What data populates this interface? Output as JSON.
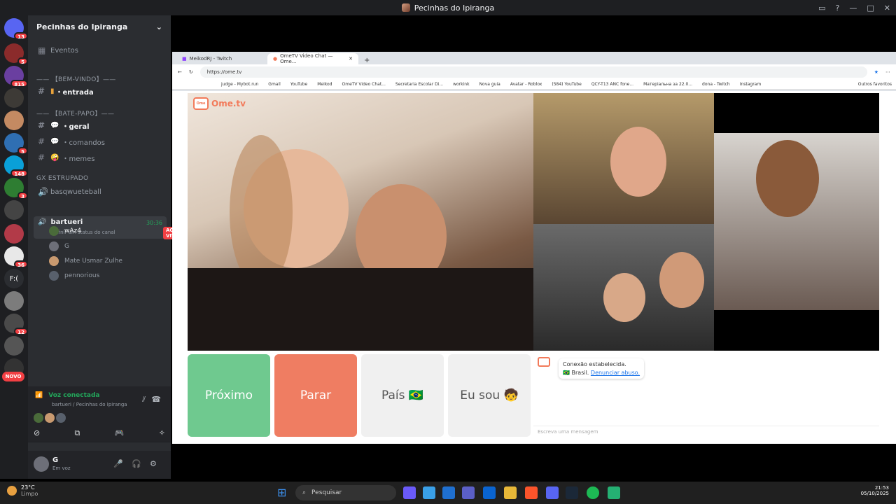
{
  "window": {
    "title": "Pecinhas do Ipiranga"
  },
  "servers": [
    {
      "badge": "13",
      "color": "#5865f2"
    },
    {
      "badge": "5",
      "color": "#8b2b2b"
    },
    {
      "badge": "815",
      "color": "#6a3fa0"
    },
    {
      "badge": "",
      "color": "#3d3a36"
    },
    {
      "badge": "",
      "color": "#c48a62"
    },
    {
      "badge": "5",
      "color": "#2f6fb3"
    },
    {
      "badge": "148",
      "color": "#0aa0d8"
    },
    {
      "badge": "3",
      "color": "#2e7d32"
    },
    {
      "badge": "",
      "color": "#444"
    },
    {
      "badge": "",
      "color": "#b23a48"
    },
    {
      "badge": "36",
      "color": "#e8e8e8"
    },
    {
      "badge": "",
      "color": "#2b2d31",
      "label": "F:("
    },
    {
      "badge": "",
      "color": "#7c7c7c"
    },
    {
      "badge": "12",
      "color": "#4a4a4a"
    },
    {
      "badge": "",
      "color": "#555"
    },
    {
      "badge": "",
      "color": "#333"
    }
  ],
  "novo_label": "NOVO",
  "guild": {
    "name": "Pecinhas do Ipiranga",
    "events": "Eventos"
  },
  "channels": {
    "cat_welcome": "—— 【BEM-VINDO】——",
    "entrada": "・entrada",
    "cat_chat": "—— 【BATE-PAPO】——",
    "geral": "・geral",
    "comandos": "・comandos",
    "memes": "・memes",
    "cat_gx": "GX ESTRUPADO",
    "basq": "basqwueteball",
    "bartueri": "bartueri",
    "bartueri_time": "30:36",
    "status_hint": "Definir um status do canal",
    "voice_users": [
      "wAz4",
      "G",
      "Mate Usmar Zulhe",
      "pennorious"
    ],
    "live": "AO VIVO"
  },
  "voice": {
    "title": "Voz conectada",
    "sub": "bartueri / Pecinhas do Ipiranga"
  },
  "user": {
    "name": "G",
    "status": "Em voz"
  },
  "browser": {
    "tab1": "MeikodRJ - Twitch",
    "tab2": "OmeTV Video Chat — Ome...",
    "url": "https://ome.tv",
    "bookmarks": [
      "judge - Mybot.run",
      "Gmail",
      "YouTube",
      "Meikod",
      "OmeTV Video Chat...",
      "Secretaria Escolar Di...",
      "workink",
      "Nova guia",
      "Avatar - Roblox",
      "(584) YouTube",
      "QCY-T13 ANC fone...",
      "Матерiальна за 22.0...",
      "dona - Twitch",
      "Instagram"
    ],
    "other_bookmarks": "Outros favoritos"
  },
  "ometv": {
    "logo": "Ome.tv",
    "btn_next": "Próximo",
    "btn_stop": "Parar",
    "btn_country": "País 🇧🇷",
    "btn_iam": "Eu sou 🧒",
    "msg_connected": "Conexão estabelecida.",
    "msg_country": "Brasil.",
    "msg_report": "Denunciar abuso.",
    "chat_placeholder": "Escreva uma mensagem"
  },
  "taskbar": {
    "weather_temp": "23°C",
    "weather_desc": "Limpo",
    "search": "Pesquisar",
    "time": "21:53",
    "date": "05/10/2025"
  }
}
